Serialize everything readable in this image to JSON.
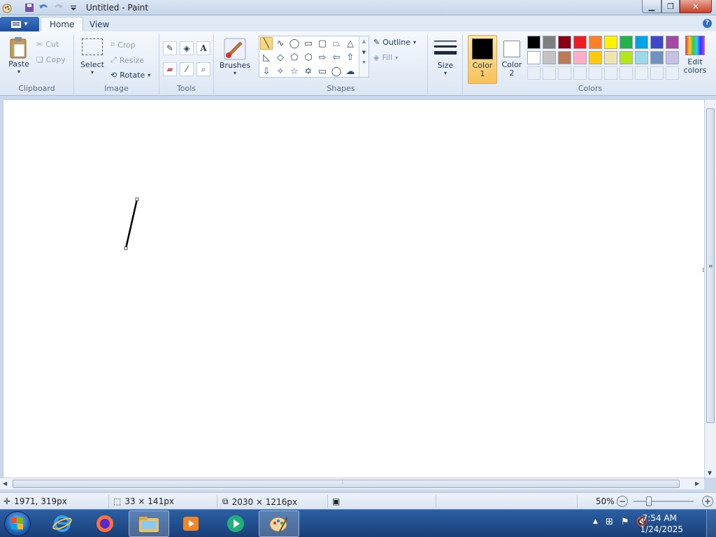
{
  "window": {
    "title": "Untitled - Paint"
  },
  "tabs": {
    "home": "Home",
    "view": "View"
  },
  "ribbon": {
    "clipboard": {
      "label": "Clipboard",
      "paste": "Paste",
      "cut": "Cut",
      "copy": "Copy"
    },
    "image": {
      "label": "Image",
      "select": "Select",
      "crop": "Crop",
      "resize": "Resize",
      "rotate": "Rotate"
    },
    "tools": {
      "label": "Tools"
    },
    "brushes": {
      "label": "Brushes"
    },
    "shapes": {
      "label": "Shapes",
      "outline": "Outline",
      "fill": "Fill"
    },
    "size": {
      "label": "Size"
    },
    "colors": {
      "label": "Colors",
      "color1_line1": "Color",
      "color1_line2": "1",
      "color2_line1": "Color",
      "color2_line2": "2",
      "edit_line1": "Edit",
      "edit_line2": "colors",
      "color1": "#000000",
      "color2": "#ffffff",
      "palette_row1": [
        "#000000",
        "#7f7f7f",
        "#880015",
        "#ed1c24",
        "#ff7f27",
        "#fff200",
        "#22b14c",
        "#00a2e8",
        "#3f48cc",
        "#a349a4"
      ],
      "palette_row2": [
        "#ffffff",
        "#c3c3c3",
        "#b97a57",
        "#ffaec9",
        "#ffc90e",
        "#efe4b0",
        "#b5e61d",
        "#99d9ea",
        "#7092be",
        "#c8bfe7"
      ]
    }
  },
  "status": {
    "cursor_pos": "1971, 319px",
    "selection_size": "33 × 141px",
    "image_size": "2030 × 1216px",
    "zoom": "50%"
  },
  "taskbar": {
    "time": "7:54 AM",
    "date": "1/24/2025"
  }
}
